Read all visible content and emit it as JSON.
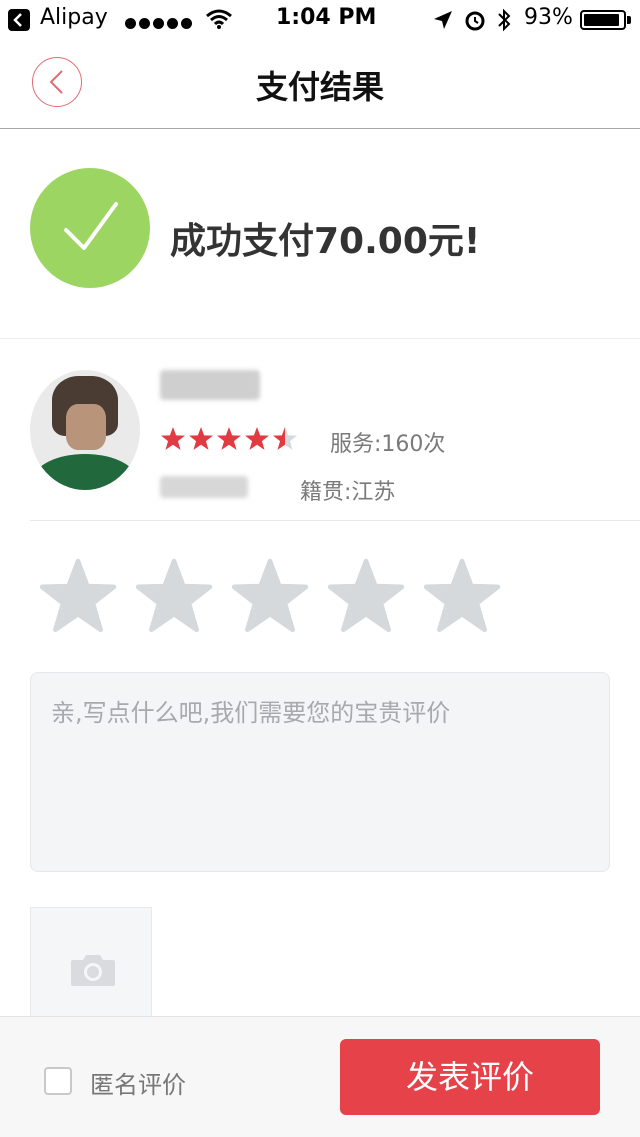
{
  "status_bar": {
    "app_name": "Alipay",
    "time": "1:04 PM",
    "battery_pct": "93%",
    "battery_level": 0.93,
    "icons": [
      "back-arrow-icon",
      "signal-dots-icon",
      "wifi-icon",
      "location-arrow-icon",
      "alarm-icon",
      "bluetooth-icon",
      "battery-icon"
    ]
  },
  "nav": {
    "title": "支付结果",
    "back_icon": "chevron-left-icon"
  },
  "success": {
    "message": "成功支付70.00元!",
    "icon": "checkmark-icon",
    "color": "#9dd562"
  },
  "provider": {
    "rating": 4.5,
    "service_count": "服务:160次",
    "hometown": "籍贯:江苏"
  },
  "rate": {
    "stars_count": 5,
    "selected": 0
  },
  "comment": {
    "placeholder": "亲,写点什么吧,我们需要您的宝贵评价",
    "value": ""
  },
  "photo": {
    "icon": "camera-icon"
  },
  "bottom": {
    "anonymous_label": "匿名评价",
    "anonymous_checked": false,
    "submit_label": "发表评价",
    "accent": "#e64249"
  }
}
